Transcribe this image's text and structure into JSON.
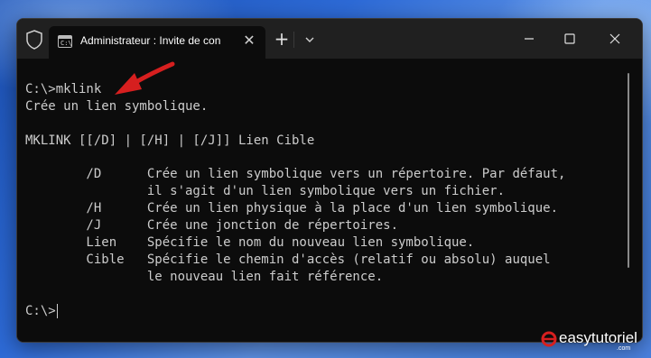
{
  "window": {
    "tab_title": "Administrateur : Invite de con",
    "tab_icon_glyph": "C:\\",
    "new_tab_label": "+",
    "close_tab_label": "✕"
  },
  "terminal": {
    "lines": [
      "C:\\>mklink",
      "Crée un lien symbolique.",
      "",
      "MKLINK [[/D] | [/H] | [/J]] Lien Cible",
      "",
      "        /D      Crée un lien symbolique vers un répertoire. Par défaut,",
      "                il s'agit d'un lien symbolique vers un fichier.",
      "        /H      Crée un lien physique à la place d'un lien symbolique.",
      "        /J      Crée une jonction de répertoires.",
      "        Lien    Spécifie le nom du nouveau lien symbolique.",
      "        Cible   Spécifie le chemin d'accès (relatif ou absolu) auquel",
      "                le nouveau lien fait référence.",
      "",
      "C:\\>"
    ]
  },
  "watermark": {
    "brand": "easytutoriel",
    "domain": ".com"
  },
  "colors": {
    "terminal_bg": "#0c0c0c",
    "titlebar_bg": "#202020",
    "text": "#cccccc",
    "arrow": "#d61f1f"
  },
  "icons": [
    "shield-icon",
    "terminal-icon",
    "close-icon",
    "plus-icon",
    "chevron-down-icon",
    "minimize-icon",
    "maximize-icon",
    "close-window-icon",
    "arrow-annotation"
  ]
}
